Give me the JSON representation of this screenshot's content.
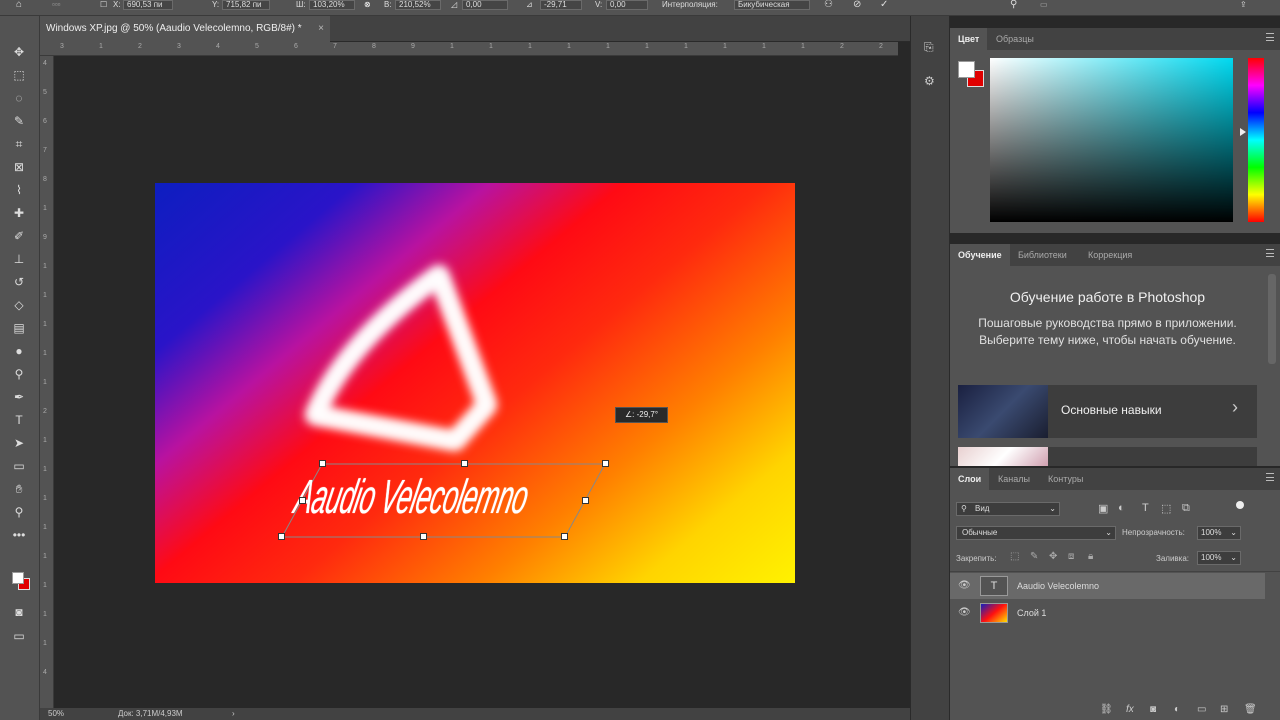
{
  "options_bar": {
    "x_label": "X:",
    "x_value": "690,53 пи",
    "y_label": "Y:",
    "y_value": "715,82 пи",
    "w_label": "Ш:",
    "w_value": "103,20%",
    "h_label": "В:",
    "h_value": "210,52%",
    "angle_value": "0,00",
    "hskew_value": "-29,71",
    "vskew_label": "V:",
    "vskew_value": "0,00",
    "interp_label": "Интерполяция:",
    "interp_value": "Бикубическая"
  },
  "document": {
    "tab_title": "Windows XP.jpg @ 50% (Aaudio Velecolemno, RGB/8#) *",
    "close": "×",
    "text_layer_content": "Aaudio Velecolemno",
    "skew_tooltip": "∠: -29,7°"
  },
  "status": {
    "zoom": "50%",
    "doc_size": "Док: 3,71M/4,93M",
    "arrow": "›"
  },
  "ruler_top_ticks": [
    "3",
    "1",
    "2",
    "3",
    "4",
    "5",
    "6",
    "7",
    "8",
    "9",
    "1",
    "1",
    "1",
    "1",
    "1",
    "1",
    "1",
    "1",
    "1",
    "1",
    "2",
    "2"
  ],
  "ruler_left_ticks": [
    "4",
    "5",
    "6",
    "7",
    "8",
    "1",
    "9",
    "1",
    "1",
    "1",
    "1",
    "1",
    "2",
    "1",
    "1",
    "1",
    "1",
    "1",
    "1",
    "1",
    "1",
    "4"
  ],
  "color_panel": {
    "tabs": [
      {
        "label": "Цвет",
        "active": true
      },
      {
        "label": "Образцы",
        "active": false
      }
    ],
    "fg_color": "#ffffff",
    "bg_color": "#e00000",
    "hue_color": "#00d9f0"
  },
  "learn_panel": {
    "tabs": [
      {
        "label": "Обучение",
        "active": true
      },
      {
        "label": "Библиотеки",
        "active": false
      },
      {
        "label": "Коррекция",
        "active": false
      }
    ],
    "title": "Обучение работе в Photoshop",
    "description": "Пошаговые руководства прямо в приложении. Выберите тему ниже, чтобы начать обучение.",
    "card_label": "Основные навыки",
    "card_arrow": "›"
  },
  "layers_panel": {
    "tabs": [
      {
        "label": "Слои",
        "active": true
      },
      {
        "label": "Каналы",
        "active": false
      },
      {
        "label": "Контуры",
        "active": false
      }
    ],
    "filter_value": "Вид",
    "blend_mode": "Обычные",
    "opacity_label": "Непрозрачность:",
    "opacity_value": "100%",
    "lock_label": "Закрепить:",
    "fill_label": "Заливка:",
    "fill_value": "100%",
    "layers": [
      {
        "name": "Aaudio Velecolemno",
        "type": "text",
        "selected": true,
        "thumb_letter": "T"
      },
      {
        "name": "Слой 1",
        "type": "pixel",
        "selected": false,
        "thumb_letter": ""
      }
    ]
  },
  "toolbar_tools": [
    "move-tool-icon",
    "marquee-tool-icon",
    "lasso-tool-icon",
    "quick-select-tool-icon",
    "crop-tool-icon",
    "frame-tool-icon",
    "eyedropper-tool-icon",
    "healing-brush-icon",
    "brush-tool-icon",
    "clone-stamp-icon",
    "history-brush-icon",
    "eraser-tool-icon",
    "gradient-tool-icon",
    "blur-tool-icon",
    "dodge-tool-icon",
    "pen-tool-icon",
    "type-tool-icon",
    "path-select-icon",
    "rectangle-tool-icon",
    "hand-tool-icon",
    "zoom-tool-icon",
    "more-tools-icon"
  ]
}
